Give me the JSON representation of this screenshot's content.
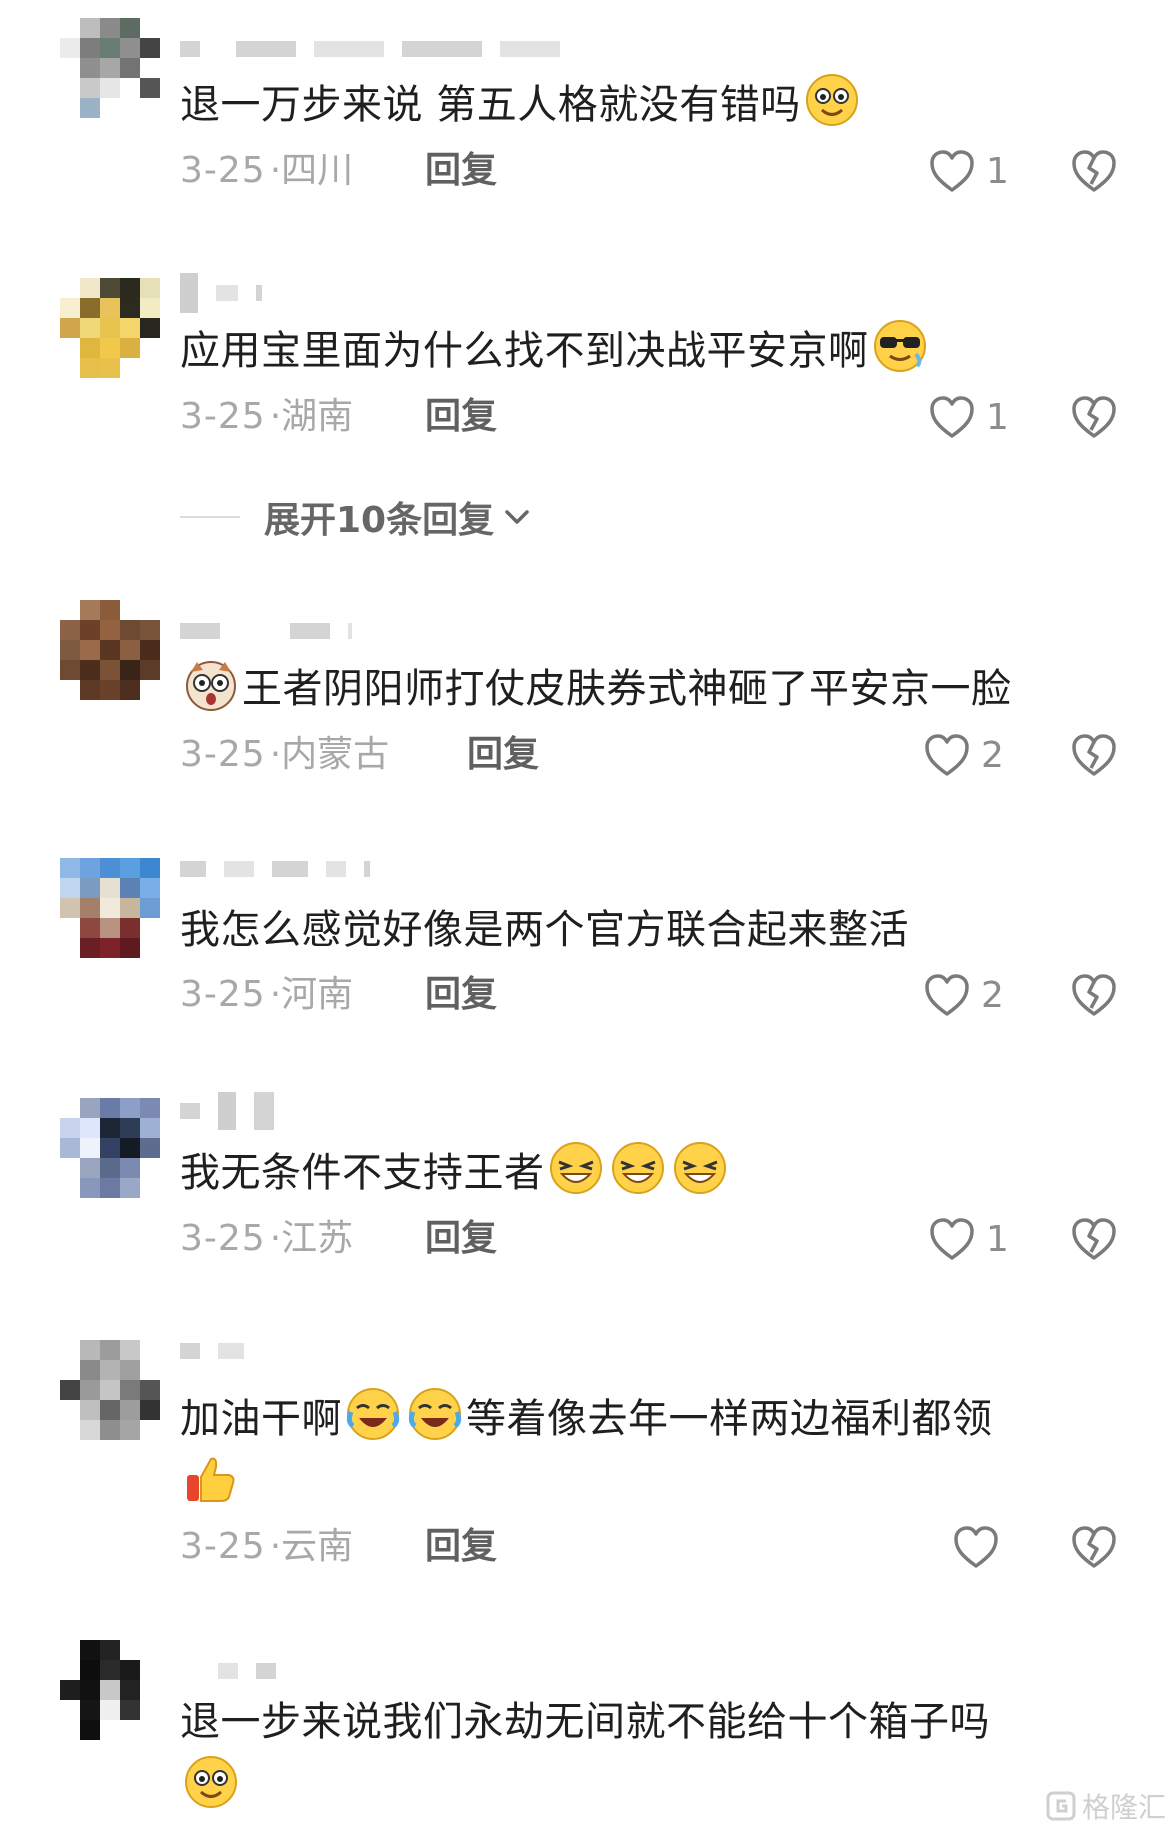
{
  "comments": [
    {
      "text": "退一万步来说 第五人格就没有错吗",
      "emojis": [
        "smile-emoji"
      ],
      "date": "3-25",
      "location": "四川",
      "reply_label": "回复",
      "likes": "1"
    },
    {
      "text": "应用宝里面为什么找不到决战平安京啊",
      "emojis": [
        "cool-sunglasses-emoji"
      ],
      "date": "3-25",
      "location": "湖南",
      "reply_label": "回复",
      "likes": "1"
    },
    {
      "text": "王者阴阳师打仗皮肤券式神砸了平安京一脸",
      "emojis": [
        "surprised-face-emoji"
      ],
      "date": "3-25",
      "location": "内蒙古",
      "reply_label": "回复",
      "likes": "2"
    },
    {
      "text": "我怎么感觉好像是两个官方联合起来整活",
      "emojis": [],
      "date": "3-25",
      "location": "河南",
      "reply_label": "回复",
      "likes": "2"
    },
    {
      "text": "我无条件不支持王者",
      "emojis": [
        "grin-squint-emoji",
        "grin-squint-emoji",
        "grin-squint-emoji"
      ],
      "date": "3-25",
      "location": "江苏",
      "reply_label": "回复",
      "likes": "1"
    },
    {
      "text_a": "加油干啊",
      "text_b": "等着像去年一样两边福利都领",
      "emojis": [
        "laugh-cry-emoji",
        "laugh-cry-emoji",
        "thumbs-up-emoji"
      ],
      "date": "3-25",
      "location": "云南",
      "reply_label": "回复",
      "likes": ""
    },
    {
      "text": "退一步来说我们永劫无间就不能给十个箱子吗",
      "emojis": [
        "smile-emoji"
      ]
    }
  ],
  "expand_replies": {
    "label": "展开10条回复"
  },
  "watermark": {
    "text": "格隆汇"
  }
}
